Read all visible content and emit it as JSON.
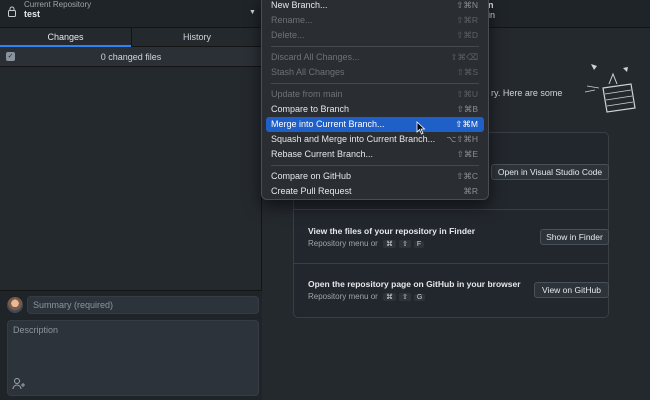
{
  "toolbar": {
    "repo_label": "Current Repository",
    "repo_name": "test",
    "branch_fragment_top": "n",
    "branch_fragment_bottom": "in"
  },
  "sidebar": {
    "tabs": [
      {
        "label": "Changes"
      },
      {
        "label": "History"
      }
    ],
    "changed_files": "0 changed files",
    "summary_placeholder": "Summary (required)",
    "description_placeholder": "Description"
  },
  "menu": {
    "items": [
      {
        "label": "New Branch...",
        "shortcut": "⇧⌘N",
        "enabled": true
      },
      {
        "label": "Rename...",
        "shortcut": "⇧⌘R",
        "enabled": false
      },
      {
        "label": "Delete...",
        "shortcut": "⇧⌘D",
        "enabled": false
      },
      {
        "label": "Discard All Changes...",
        "shortcut": "⇧⌘⌫",
        "enabled": false
      },
      {
        "label": "Stash All Changes",
        "shortcut": "⇧⌘S",
        "enabled": false
      },
      {
        "label": "Update from main",
        "shortcut": "⇧⌘U",
        "enabled": false
      },
      {
        "label": "Compare to Branch",
        "shortcut": "⇧⌘B",
        "enabled": true
      },
      {
        "label": "Merge into Current Branch...",
        "shortcut": "⇧⌘M",
        "enabled": true
      },
      {
        "label": "Squash and Merge into Current Branch...",
        "shortcut": "⌥⇧⌘H",
        "enabled": true
      },
      {
        "label": "Rebase Current Branch...",
        "shortcut": "⇧⌘E",
        "enabled": true
      },
      {
        "label": "Compare on GitHub",
        "shortcut": "⇧⌘C",
        "enabled": true
      },
      {
        "label": "Create Pull Request",
        "shortcut": "⌘R",
        "enabled": true
      }
    ]
  },
  "main": {
    "intro_fragment": "ry. Here are some",
    "cards": [
      {
        "title": "",
        "subtitle": "",
        "button": "Open in Visual Studio Code"
      },
      {
        "title": "View the files of your repository in Finder",
        "subtitle": "Repository menu or",
        "keys": [
          "⌘",
          "⇧",
          "F"
        ],
        "button": "Show in Finder"
      },
      {
        "title": "Open the repository page on GitHub in your browser",
        "subtitle": "Repository menu or",
        "keys": [
          "⌘",
          "⇧",
          "G"
        ],
        "button": "View on GitHub"
      }
    ]
  },
  "colors": {
    "accent": "#1f5fc8",
    "tab_underline": "#2f81f7",
    "background": "#24292e"
  },
  "icons": [
    "lock-icon",
    "chevron-down-icon",
    "checkbox-icon",
    "avatar",
    "add-coauthor-icon",
    "mouse-pointer-icon",
    "illustration"
  ]
}
